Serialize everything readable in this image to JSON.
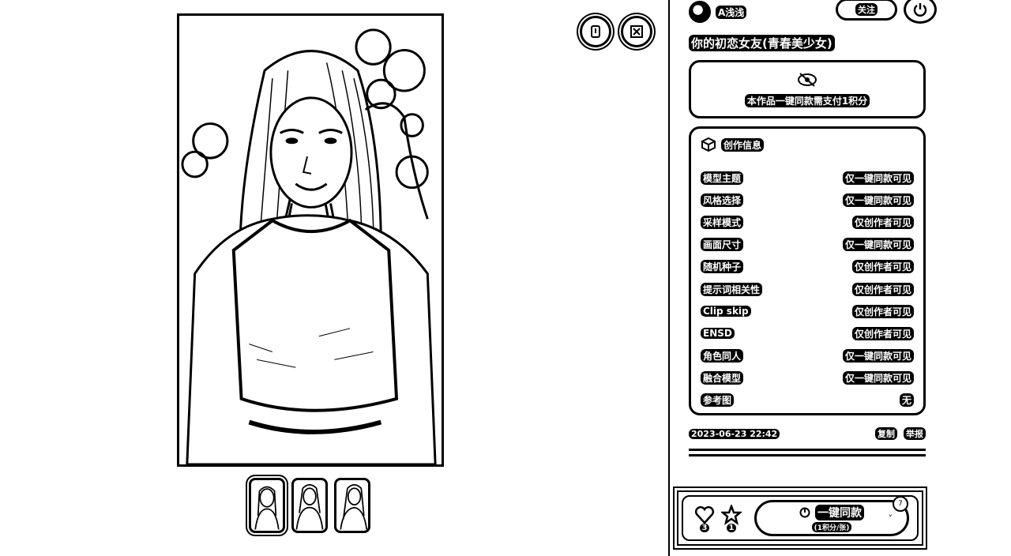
{
  "author": {
    "name": "A浅浅",
    "follow_label": "关注"
  },
  "work": {
    "title": "你的初恋女友(青春美少女)"
  },
  "pay": {
    "text": "本作品一键同款需支付1积分"
  },
  "info": {
    "heading": "创作信息",
    "rows": [
      {
        "label": "模型主题",
        "value": "仅一键同款可见"
      },
      {
        "label": "风格选择",
        "value": "仅一键同款可见"
      },
      {
        "label": "采样模式",
        "value": "仅创作者可见"
      },
      {
        "label": "画面尺寸",
        "value": "仅一键同款可见"
      },
      {
        "label": "随机种子",
        "value": "仅创作者可见"
      },
      {
        "label": "提示词相关性",
        "value": "仅创作者可见"
      },
      {
        "label": "Clip skip",
        "value": "仅创作者可见"
      },
      {
        "label": "ENSD",
        "value": "仅创作者可见"
      },
      {
        "label": "角色同人",
        "value": "仅一键同款可见"
      },
      {
        "label": "融合模型",
        "value": "仅一键同款可见"
      },
      {
        "label": "参考图",
        "value": "无"
      }
    ]
  },
  "meta": {
    "date": "2023-06-23 22:42",
    "share_label": "复制",
    "report_label": "举报"
  },
  "actions": {
    "like_count": "3",
    "star_count": "1",
    "one_click_label": "一键同款",
    "one_click_sub": "(1积分/张)",
    "badge": "7",
    "caret": "˅"
  },
  "icons": {
    "download": "download-icon",
    "fullscreen": "fullscreen-icon",
    "power": "power-icon",
    "eye_off": "eye-off-icon",
    "cube": "cube-icon",
    "heart": "heart-icon",
    "star": "star-icon"
  },
  "thumbnails": {
    "count": 3,
    "active_index": 0
  }
}
